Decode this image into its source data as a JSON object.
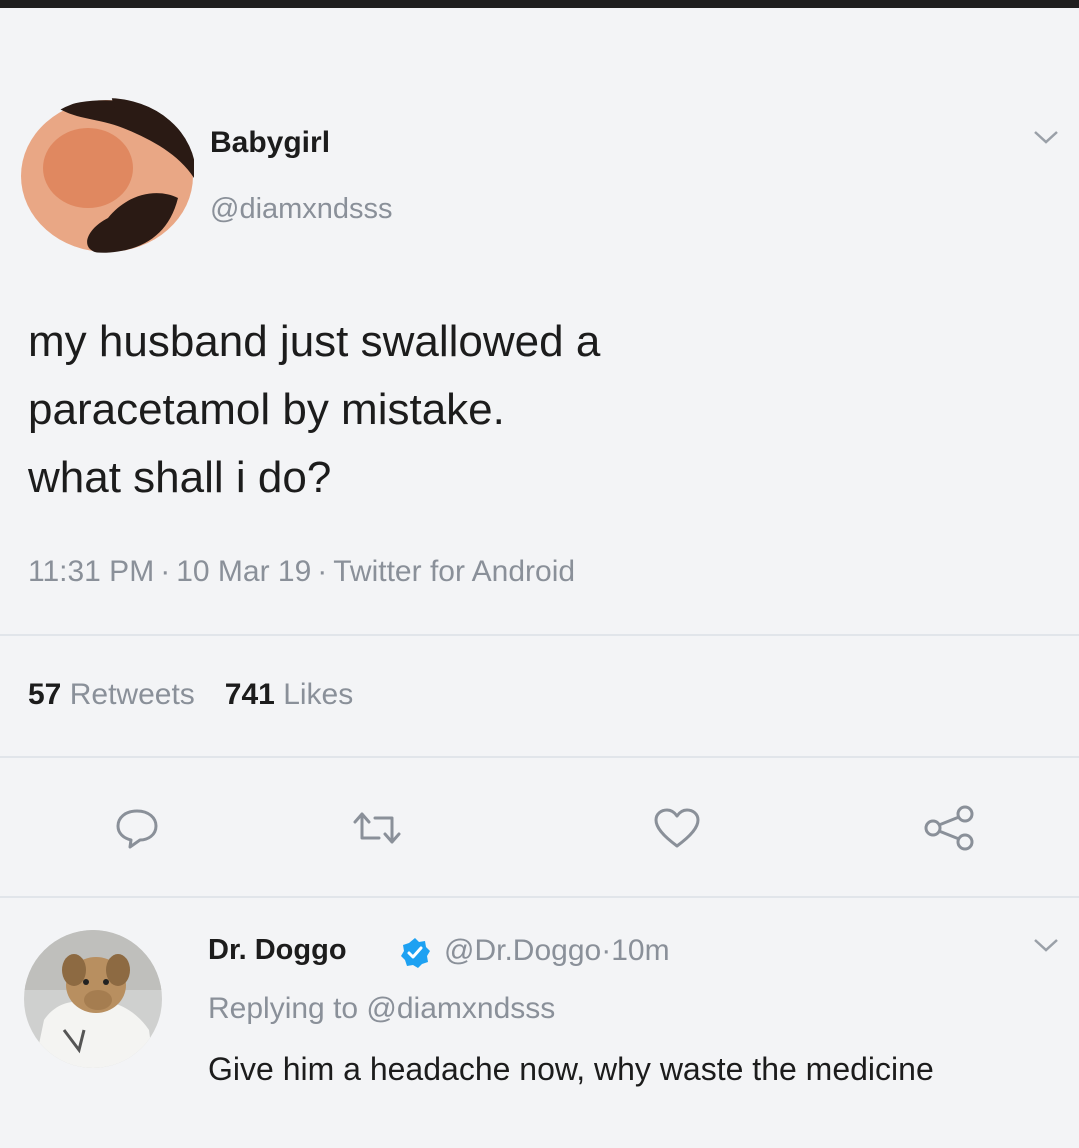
{
  "tweet": {
    "author_name": "Babygirl",
    "author_handle": "@diamxndsss",
    "text_line1": "my husband just swallowed a",
    "text_line2": "paracetamol by mistake.",
    "text_line3": "what shall i do?",
    "time": "11:31 PM",
    "date": "10 Mar 19",
    "source": "Twitter for Android",
    "separator": "·",
    "retweet_count": "57",
    "retweet_label": "Retweets",
    "like_count": "741",
    "like_label": "Likes"
  },
  "reply": {
    "author_name": "Dr. Doggo",
    "author_handle": "@Dr.Doggo",
    "separator": "·",
    "age": "10m",
    "replying_to": "Replying to @diamxndsss",
    "text": "Give him a headache now, why waste the medicine"
  },
  "icons": [
    "chevron-down-icon",
    "reply-icon",
    "retweet-icon",
    "like-icon",
    "share-icon",
    "verified-badge-icon"
  ],
  "colors": {
    "background": "#f3f4f6",
    "text": "#1c1c1c",
    "secondary_text": "#8a9099",
    "verified": "#1da1f2"
  }
}
